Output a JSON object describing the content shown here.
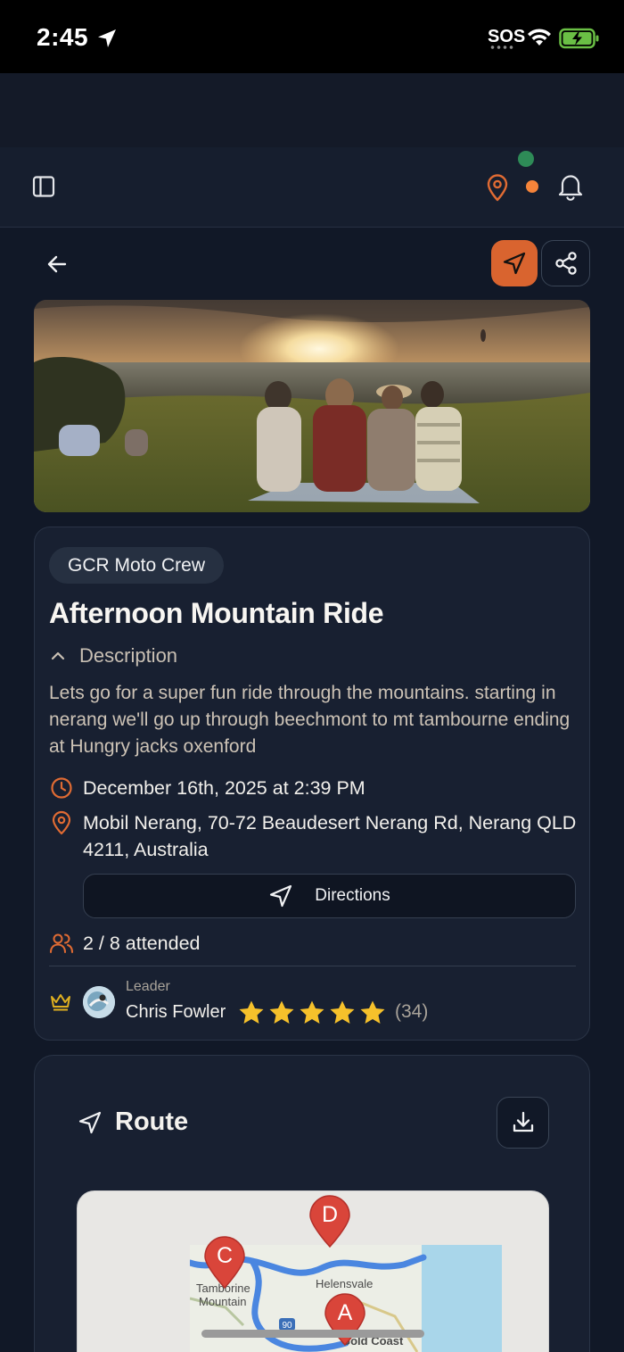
{
  "status_bar": {
    "time": "2:45",
    "sos": "SOS",
    "icons": [
      "location-arrow-icon",
      "wifi-icon",
      "battery-charging-icon"
    ]
  },
  "header": {
    "icons": [
      "sidebar-toggle-icon",
      "map-pin-icon",
      "bell-icon"
    ],
    "colors": {
      "online_dot": "#2e8b57",
      "notification_dot": "#f5843a"
    }
  },
  "actions": {
    "icons": [
      "back-arrow-icon",
      "navigation-icon",
      "share-icon"
    ],
    "accent": "#d9642f"
  },
  "event": {
    "group": "GCR Moto Crew",
    "title": "Afternoon Mountain Ride",
    "description_label": "Description",
    "description": "Lets go for a super fun ride through the mountains. starting in nerang we'll go up through beechmont to mt tambourne ending at Hungry jacks oxenford",
    "datetime": "December 16th, 2025 at 2:39 PM",
    "address": "Mobil Nerang, 70-72 Beaudesert Nerang Rd, Nerang QLD 4211, Australia",
    "directions_label": "Directions",
    "attendance": "2 / 8 attended",
    "leader_caption": "Leader",
    "leader_name": "Chris Fowler",
    "rating_stars": 5,
    "rating_count": "(34)"
  },
  "route": {
    "title": "Route",
    "map_labels": [
      "Tamborine",
      "Mountain",
      "Helensvale",
      "Gold Coast",
      "90"
    ],
    "markers": [
      "A",
      "C",
      "D"
    ]
  }
}
